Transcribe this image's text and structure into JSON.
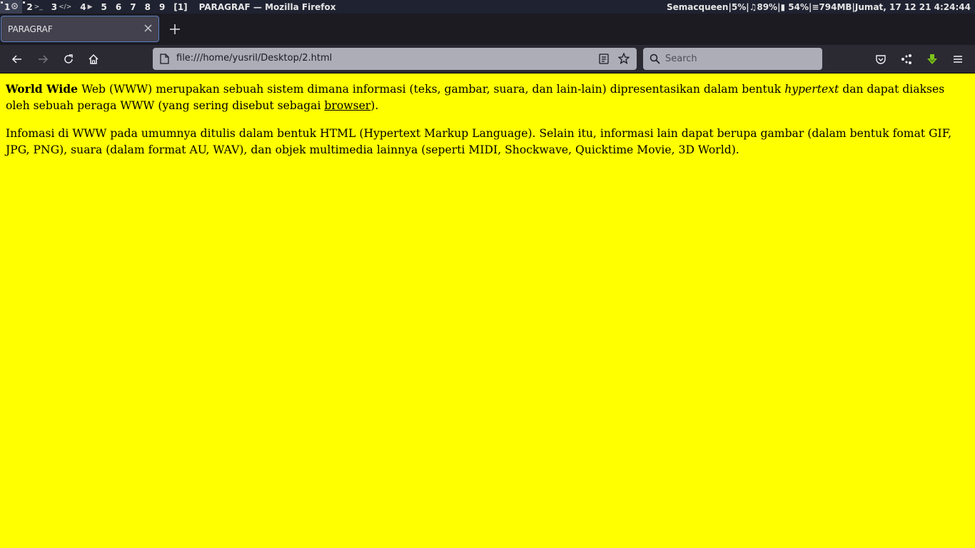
{
  "system_bar": {
    "workspaces": [
      {
        "label": "1",
        "icon": "firefox-glyph",
        "glyph": "⚙"
      },
      {
        "label": "2",
        "icon": "terminal-glyph",
        "glyph": ">_"
      },
      {
        "label": "3",
        "icon": "code-glyph",
        "glyph": "</>"
      },
      {
        "label": "4",
        "icon": "play-glyph",
        "glyph": "▶"
      },
      {
        "label": "5"
      },
      {
        "label": "6"
      },
      {
        "label": "7"
      },
      {
        "label": "8"
      },
      {
        "label": "9"
      },
      {
        "label": "[1]"
      }
    ],
    "window_title": "PARAGRAF — Mozilla Firefox",
    "status": "Semacqueen|5%|♫89%|▮ 54%|≡794MB|Jumat, 17 12 21 4:24:44"
  },
  "browser": {
    "tab": {
      "title": "PARAGRAF"
    },
    "url": "file:///home/yusril/Desktop/2.html",
    "search_placeholder": "Search"
  },
  "page": {
    "p1": {
      "bold": "World Wide",
      "text1": " Web (WWW) merupakan sebuah sistem dimana informasi (teks, gambar, suara, dan lain-lain) dipresentasikan dalam bentuk ",
      "italic": "hypertext",
      "text2": " dan dapat diakses oleh sebuah peraga WWW (yang sering disebut sebagai ",
      "link": "browser",
      "text3": ")."
    },
    "p2": "Infomasi di WWW pada umumnya ditulis dalam bentuk HTML (Hypertext Markup Language). Selain itu, informasi lain dapat berupa gambar (dalam bentuk fomat GIF, JPG, PNG), suara (dalam format AU, WAV), dan objek multimedia lainnya (seperti MIDI, Shockwave, Quicktime Movie, 3D World)."
  },
  "colors": {
    "page_background": "#ffff00",
    "toolbar": "#2b2a33",
    "download_accent": "#7ec41b"
  }
}
